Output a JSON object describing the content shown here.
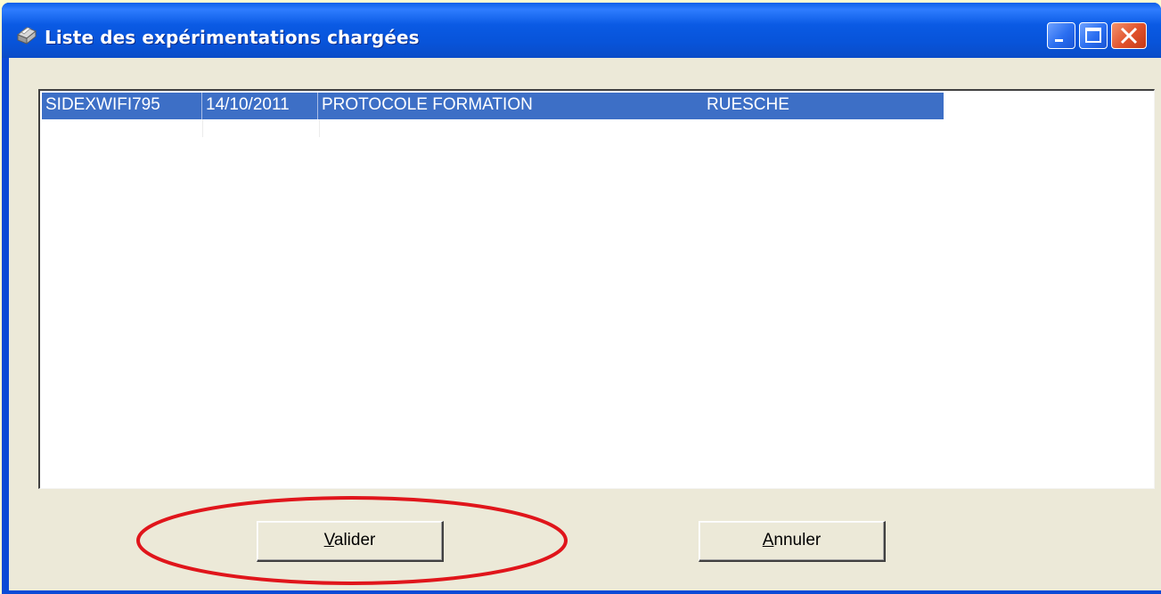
{
  "window": {
    "title": "Liste des expérimentations chargées",
    "icon": "printer-icon",
    "controls": [
      "minimize-icon",
      "maximize-icon",
      "close-icon"
    ]
  },
  "list": {
    "rows": [
      {
        "id": "SIDEXWIFI795",
        "date": "14/10/2011",
        "protocol": "PROTOCOLE FORMATION",
        "name": "RUESCHE",
        "selected": true
      }
    ]
  },
  "buttons": {
    "valider": {
      "label": "Valider",
      "mnemonic": "V"
    },
    "annuler": {
      "label": "Annuler",
      "mnemonic": "A"
    }
  },
  "annotation": {
    "shape": "ellipse",
    "color": "#e0151b",
    "target": "valider"
  },
  "colors": {
    "titlebar": "#0a5ae4",
    "selection": "#3d6fc6",
    "window_bg": "#ece9d8",
    "page_bg": "#fdfbd2"
  }
}
